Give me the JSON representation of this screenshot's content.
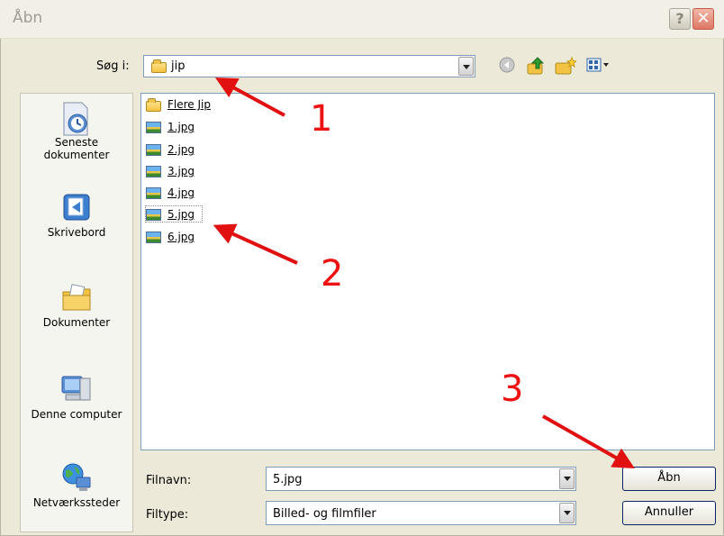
{
  "window": {
    "title": "Åbn",
    "help_label": "?",
    "close_label": "✕"
  },
  "look_in": {
    "label": "Søg i:",
    "value": "jip"
  },
  "nav_icons": [
    "back-icon",
    "up-folder-icon",
    "new-folder-icon",
    "views-menu-icon"
  ],
  "places": [
    {
      "label": "Seneste dokumenter",
      "icon": "recent-documents-icon"
    },
    {
      "label": "Skrivebord",
      "icon": "desktop-icon"
    },
    {
      "label": "Dokumenter",
      "icon": "my-documents-icon"
    },
    {
      "label": "Denne computer",
      "icon": "my-computer-icon"
    },
    {
      "label": "Netværkssteder",
      "icon": "network-places-icon"
    }
  ],
  "files": [
    {
      "name": "Flere Jip",
      "type": "folder"
    },
    {
      "name": "1.jpg",
      "type": "image"
    },
    {
      "name": "2.jpg",
      "type": "image"
    },
    {
      "name": "3.jpg",
      "type": "image"
    },
    {
      "name": "4.jpg",
      "type": "image"
    },
    {
      "name": "5.jpg",
      "type": "image",
      "selected": true
    },
    {
      "name": "6.jpg",
      "type": "image"
    }
  ],
  "filename": {
    "label": "Filnavn:",
    "value": "5.jpg"
  },
  "filetype": {
    "label": "Filtype:",
    "value": "Billed- og filmfiler"
  },
  "buttons": {
    "open": "Åbn",
    "cancel": "Annuller"
  },
  "annotations": [
    "1",
    "2",
    "3"
  ],
  "colors": {
    "annotation": "#e11111",
    "link_border": "#7f9db9"
  }
}
